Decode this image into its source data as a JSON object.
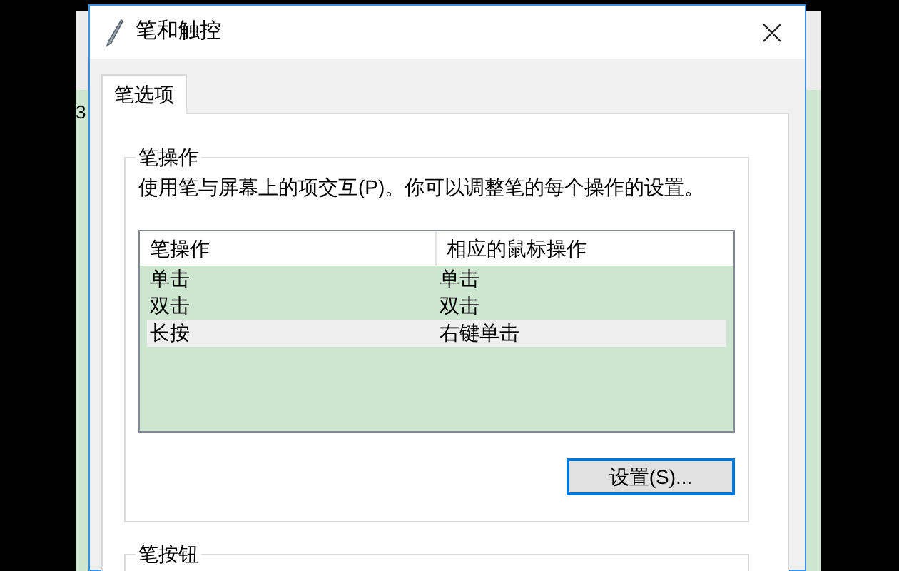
{
  "background_window": {
    "text": "3"
  },
  "window": {
    "title": "笔和触控"
  },
  "tabs": [
    {
      "label": "笔选项",
      "selected": true
    }
  ],
  "pen_actions_group": {
    "title": "笔操作",
    "description": "使用笔与屏幕上的项交互(P)。你可以调整笔的每个操作的设置。",
    "table": {
      "columns": [
        "笔操作",
        "相应的鼠标操作"
      ],
      "rows": [
        {
          "cells": [
            "单击",
            "单击"
          ],
          "selected": false
        },
        {
          "cells": [
            "双击",
            "双击"
          ],
          "selected": false
        },
        {
          "cells": [
            "长按",
            "右键单击"
          ],
          "selected": true
        }
      ]
    },
    "button": "设置(S)..."
  },
  "pen_buttons_group": {
    "title": "笔按钮"
  }
}
